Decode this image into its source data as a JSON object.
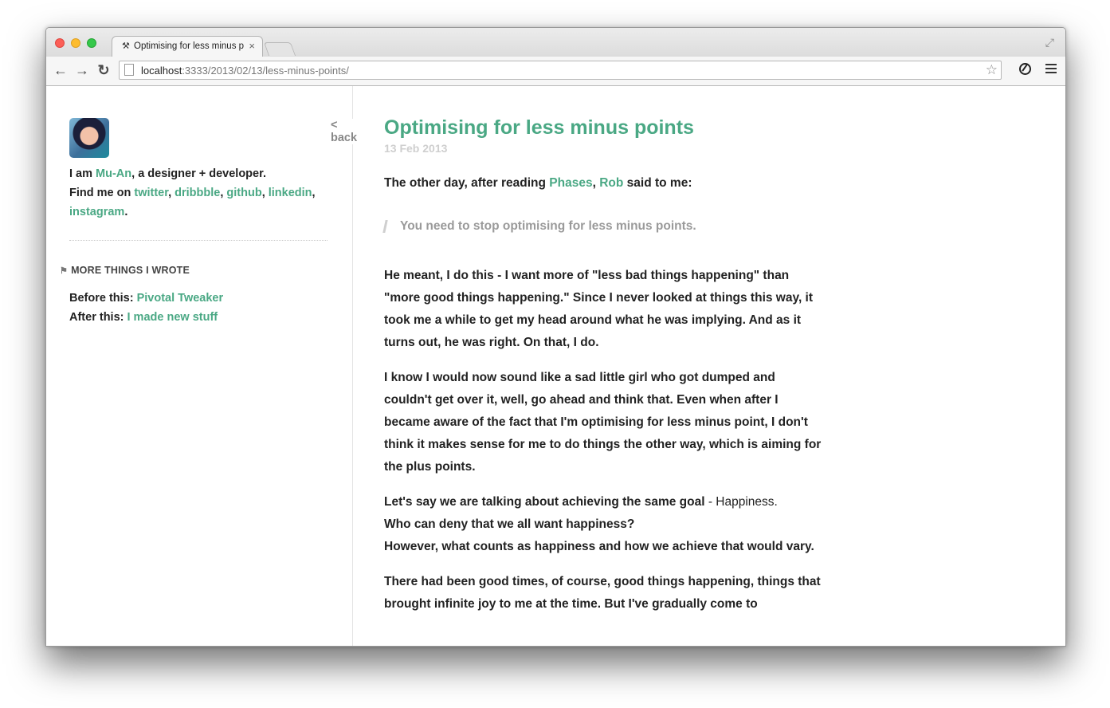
{
  "browser": {
    "tab_title": "Optimising for less minus points",
    "tab_favicon": "⚒",
    "url_host": "localhost",
    "url_path": ":3333/2013/02/13/less-minus-points/"
  },
  "sidebar": {
    "bio_line1_prefix": "I am ",
    "bio_name": "Mu-An",
    "bio_line1_suffix": ", a designer + developer.",
    "bio_line2_prefix": "Find me on ",
    "links": [
      "twitter",
      "dribbble",
      "github",
      "linkedin",
      "instagram"
    ],
    "more_heading": "MORE THINGS I WROTE",
    "before_label": "Before this: ",
    "before_link": "Pivotal Tweaker",
    "after_label": "After this: ",
    "after_link": "I made new stuff",
    "back_label": "< back"
  },
  "article": {
    "title": "Optimising for less minus points",
    "date": "13 Feb 2013",
    "intro_prefix": "The other day, after reading ",
    "intro_link1": "Phases",
    "intro_link2": "Rob",
    "intro_suffix": " said to me:",
    "quote": "You need to stop optimising for less minus points.",
    "p1": "He meant, I do this - I want more of \"less bad things happening\" than \"more good things happening.\" Since I never looked at things this way, it took me a while to get my head around what he was implying. And as it turns out, he was right. On that, I do.",
    "p2": "I know I would now sound like a sad little girl who got dumped and couldn't get over it, well, go ahead and think that. Even when after I became aware of the fact that I'm optimising for less minus point, I don't think it makes sense for me to do things the other way, which is aiming for the plus points.",
    "p3_prefix": "Let's say we are talking about achieving the same goal",
    "p3_light": " - Happiness.",
    "p3_line2": "Who can deny that we all want happiness?",
    "p3_line3": "However, what counts as happiness and how we achieve that would vary.",
    "p4": "There had been good times, of course, good things happening, things that brought infinite joy to me at the time. But I've gradually come to"
  }
}
